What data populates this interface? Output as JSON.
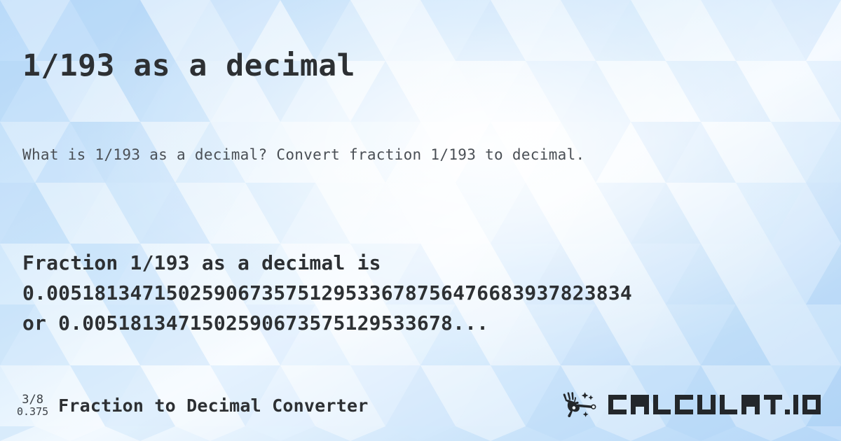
{
  "page": {
    "title": "1/193 as a decimal",
    "subtitle": "What is 1/193 as a decimal? Convert fraction 1/193 to decimal.",
    "answer_line1": "Fraction 1/193 as a decimal is",
    "answer_line2": "0.0051813471502590673575129533678756476683937823834",
    "answer_line3": "or 0.0051813471502590673575129533678...",
    "background_color": "#cfe4f8",
    "text_color": "#2d3033",
    "subtitle_color": "#4a4f55"
  },
  "footer": {
    "fraction_icon_numerator": "3/8",
    "fraction_icon_decimal": "0.375",
    "tool_name": "Fraction to Decimal Converter",
    "brand_name": "CALCULAT.IO",
    "brand_icon": "magic-wand-hand-icon"
  }
}
